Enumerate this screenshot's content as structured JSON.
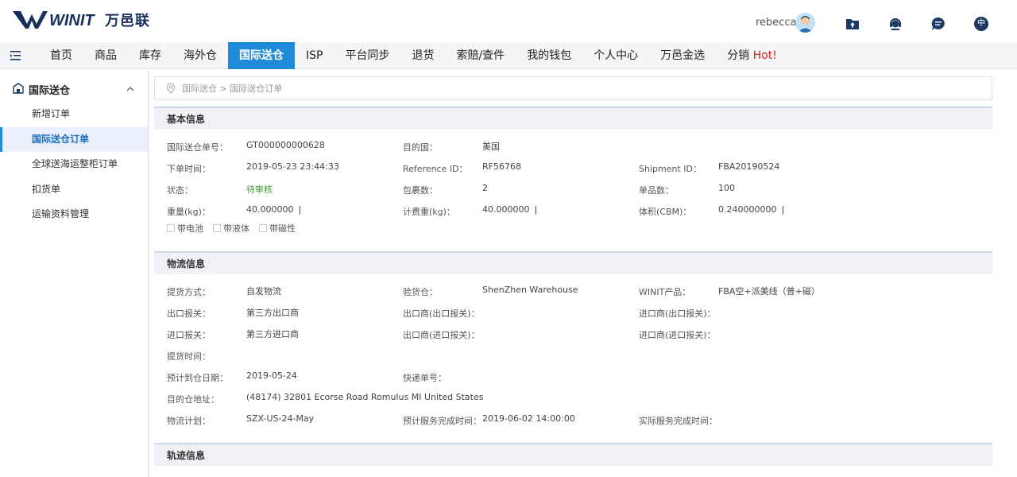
{
  "brand": {
    "logo_text": "WINIT",
    "logo_cn": "万邑联"
  },
  "user": {
    "name": "rebecca"
  },
  "top_icons": [
    "folder-upload-icon",
    "headset-icon",
    "chat-icon",
    "language-cn-icon"
  ],
  "top_icon_labels": {
    "language": "中"
  },
  "colors": {
    "accent": "#1f8bd8",
    "hot": "#e02020",
    "pending": "#4a9a3a"
  },
  "nav": {
    "items": [
      {
        "label": "首页"
      },
      {
        "label": "商品"
      },
      {
        "label": "库存"
      },
      {
        "label": "海外仓"
      },
      {
        "label": "国际送仓",
        "active": true
      },
      {
        "label": "ISP"
      },
      {
        "label": "平台同步"
      },
      {
        "label": "退货"
      },
      {
        "label": "索赔/查件"
      },
      {
        "label": "我的钱包"
      },
      {
        "label": "个人中心"
      },
      {
        "label": "万邑金选"
      },
      {
        "label": "分销"
      }
    ],
    "hot_label": "Hot!"
  },
  "sidebar": {
    "title": "国际送仓",
    "items": [
      {
        "label": "新增订单"
      },
      {
        "label": "国际送仓订单",
        "active": true
      },
      {
        "label": "全球送海运整柜订单"
      },
      {
        "label": "扣货单"
      },
      {
        "label": "运输资料管理"
      }
    ]
  },
  "breadcrumb": {
    "text": "国际送仓 > 国际送仓订单"
  },
  "basic": {
    "title": "基本信息",
    "order_no_label": "国际送仓单号：",
    "order_no": "GT000000000628",
    "dest_country_label": "目的国：",
    "dest_country": "美国",
    "order_time_label": "下单时间：",
    "order_time": "2019-05-23 23:44:33",
    "ref_id_label": "Reference ID：",
    "ref_id": "RF56768",
    "shipment_id_label": "Shipment ID：",
    "shipment_id": "FBA20190524",
    "status_label": "状态：",
    "status": "待审核",
    "packages_label": "包裹数：",
    "packages": "2",
    "items_label": "单品数：",
    "items": "100",
    "weight_label": "重量(kg)：",
    "weight": "40.000000",
    "charge_weight_label": "计费重(kg)：",
    "charge_weight": "40.000000",
    "volume_label": "体积(CBM)：",
    "volume": "0.240000000",
    "separator": "|",
    "checks": [
      "带电池",
      "带液体",
      "带磁性"
    ]
  },
  "logistics": {
    "title": "物流信息",
    "pickup_method_label": "提货方式：",
    "pickup_method": "自发物流",
    "check_warehouse_label": "验货仓：",
    "check_warehouse": "ShenZhen Warehouse",
    "winit_product_label": "WINIT产品：",
    "winit_product": "FBA空+派美线（普+磁）",
    "export_decl_label": "出口报关：",
    "export_decl": "第三方出口商",
    "exporter_label": "出口商(出口报关)：",
    "importer_export_label": "进口商(出口报关)：",
    "import_decl_label": "进口报关：",
    "import_decl": "第三方进口商",
    "exporter_import_label": "出口商(进口报关)：",
    "importer_import_label": "进口商(进口报关)：",
    "pickup_time_label": "提货时间：",
    "eta_label": "预计到仓日期：",
    "eta": "2019-05-24",
    "tracking_no_label": "快递单号：",
    "dest_address_label": "目的仓地址：",
    "dest_address": "(48174) 32801 Ecorse Road Romulus MI United States",
    "plan_label": "物流计划：",
    "plan": "SZX-US-24-May",
    "est_complete_label": "预计服务完成时间：",
    "est_complete": "2019-06-02 14:00:00",
    "actual_complete_label": "实际服务完成时间："
  },
  "tracking": {
    "title": "轨迹信息"
  }
}
